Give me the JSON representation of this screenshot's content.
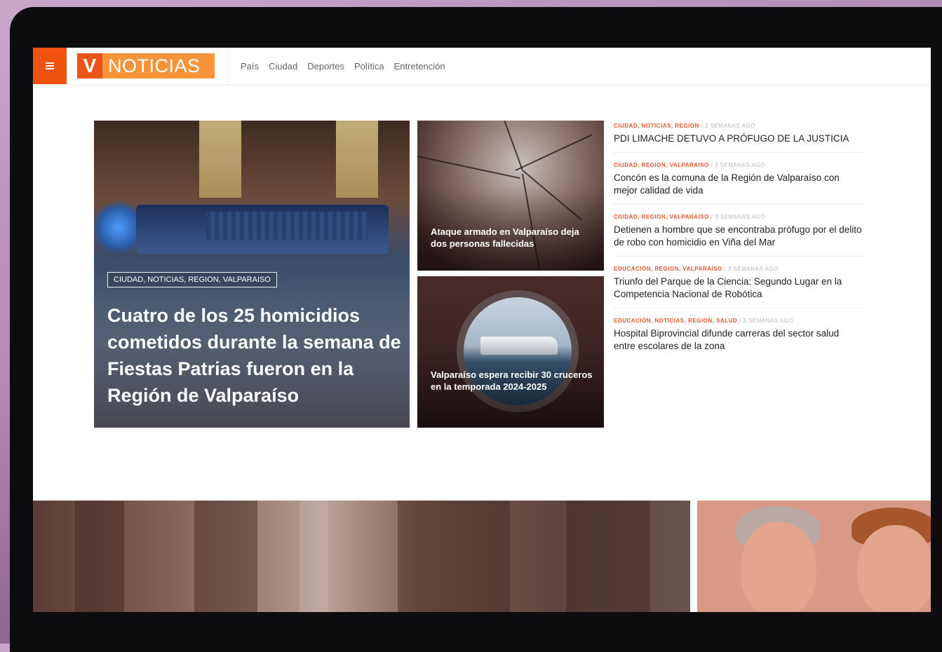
{
  "header": {
    "logo_letter": "V",
    "logo_name": "NOTICIAS",
    "nav": [
      "País",
      "Ciudad",
      "Deportes",
      "Política",
      "Entretención"
    ]
  },
  "hero": {
    "category": "CIUDAD, NOTICIAS, REGION, VALPARAISO",
    "title": "Cuatro de los 25 homicidios cometidos durante la semana de Fiestas Patrias fueron en la Región de Valparaíso"
  },
  "cards": [
    {
      "title": "Ataque armado en Valparaíso deja dos personas fallecidas"
    },
    {
      "title": "Valparaíso espera recibir 30 cruceros en la temporada 2024-2025"
    }
  ],
  "headlines": [
    {
      "category": "CIUDAD, NOTICIAS, REGION",
      "time": "2 SEMANAS AGO",
      "title": "PDI LIMACHE DETUVO A PRÓFUGO DE LA JUSTICIA"
    },
    {
      "category": "CIUDAD, REGION, VALPARAISO",
      "time": "3 SEMANAS AGO",
      "title": "Concón es la comuna de la Región de Valparaíso con mejor calidad de vida"
    },
    {
      "category": "CIUDAD, REGION, VALPARAISO",
      "time": "3 SEMANAS AGO",
      "title": "Detienen a hombre que se encontraba prófugo por el delito de robo con homicidio en Viña del Mar"
    },
    {
      "category": "EDUCACIÓN, REGION, VALPARAISO",
      "time": "3 SEMANAS AGO",
      "title": "Triunfo del Parque de la Ciencia: Segundo Lugar en la Competencia Nacional de Robótica"
    },
    {
      "category": "EDUCACIÓN, NOTICIAS, REGION, SALUD",
      "time": "3 SEMANAS AGO",
      "title": "Hospital Biprovincial difunde carreras del sector salud entre escolares de la zona"
    }
  ],
  "separator": " / ",
  "colors": {
    "accent": "#f0530f",
    "logo_bg": "#f7943a",
    "category": "#e4572e"
  }
}
